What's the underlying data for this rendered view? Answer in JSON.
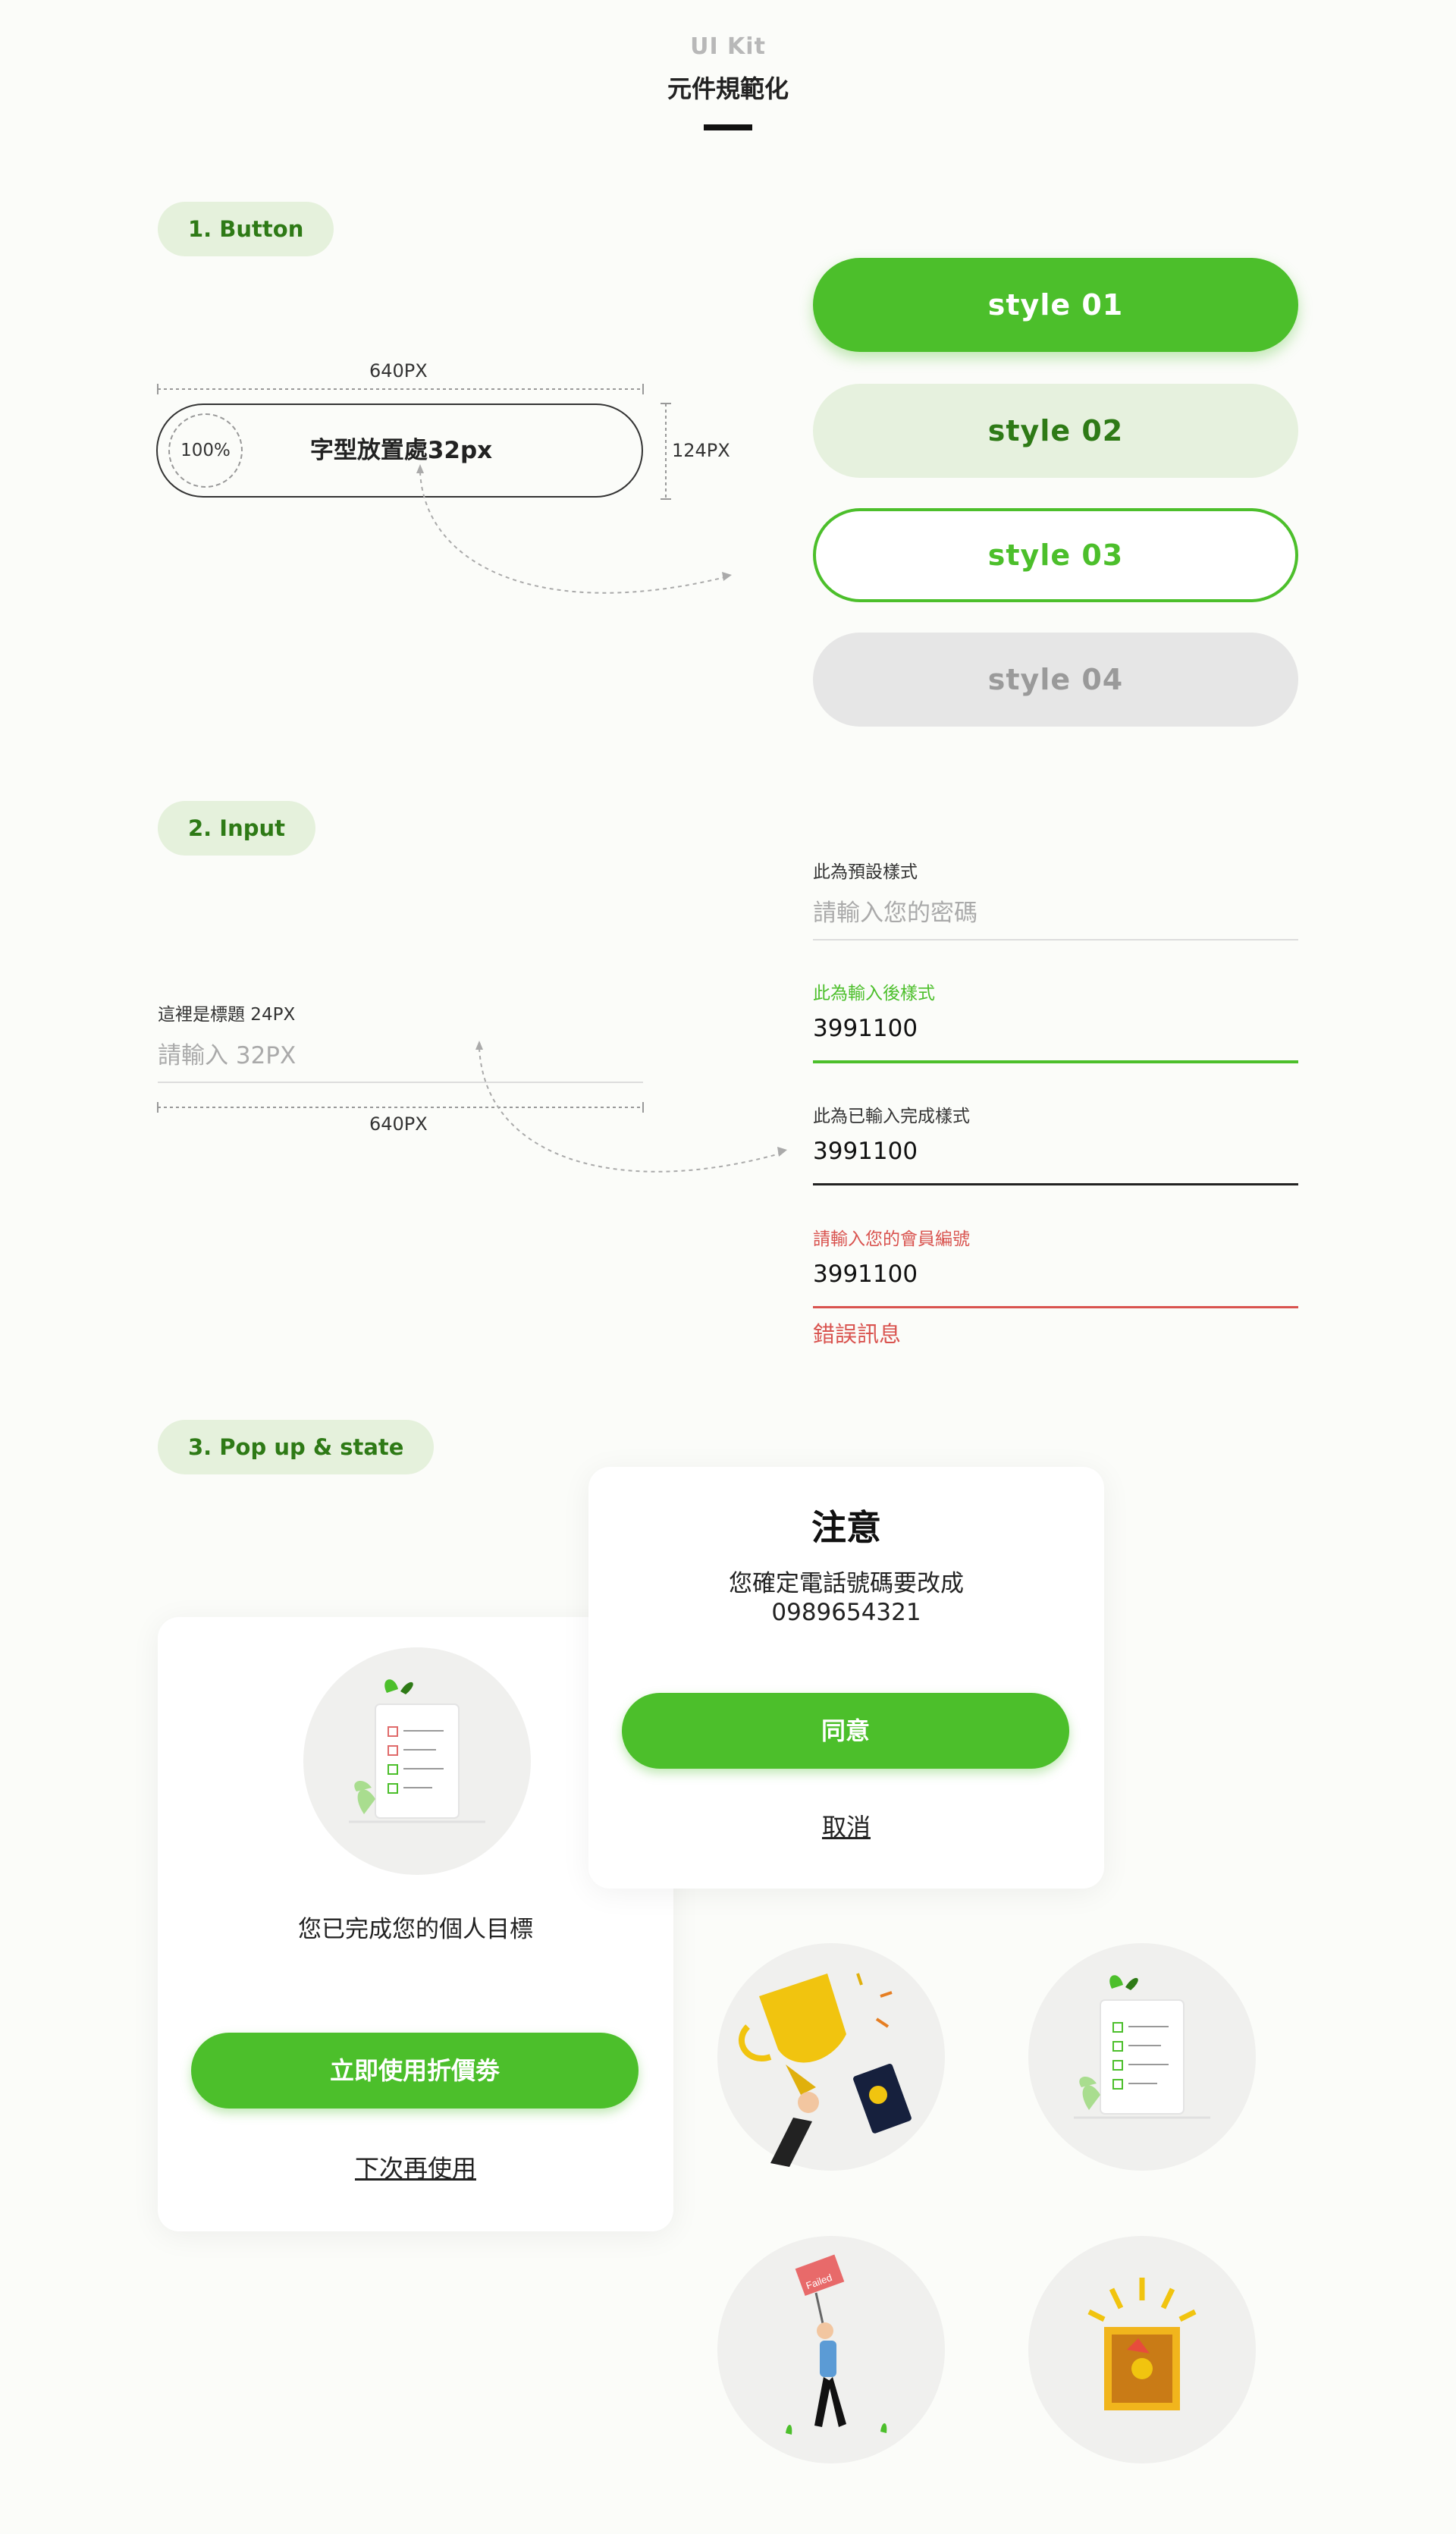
{
  "header": {
    "kit_label": "UI Kit",
    "title": "元件規範化"
  },
  "sections": {
    "button": "1. Button",
    "input": "2. Input",
    "popup": "3. Pop up & state"
  },
  "button_spec": {
    "width_label": "640PX",
    "height_label": "124PX",
    "radius_label": "100%",
    "text_label": "字型放置處32px"
  },
  "button_styles": [
    "style 01",
    "style 02",
    "style 03",
    "style 04"
  ],
  "input_spec": {
    "title_label": "這裡是標題 24PX",
    "placeholder": "請輸入 32PX",
    "width_label": "640PX"
  },
  "inputs": {
    "default": {
      "label": "此為預設樣式",
      "placeholder": "請輸入您的密碼"
    },
    "typing": {
      "label": "此為輸入後樣式",
      "value": "3991100"
    },
    "filled": {
      "label": "此為已輸入完成樣式",
      "value": "3991100"
    },
    "error": {
      "label": "請輸入您的會員編號",
      "value": "3991100",
      "message": "錯誤訊息"
    }
  },
  "popup_confirm": {
    "title": "注意",
    "message_line1": "您確定電話號碼要改成",
    "message_line2": "0989654321",
    "confirm_label": "同意",
    "cancel_label": "取消"
  },
  "popup_complete": {
    "message": "您已完成您的個人目標",
    "primary_label": "立即使用折價劵",
    "secondary_label": "下次再使用"
  },
  "illustrations": {
    "failed_sign": "Failed"
  },
  "colors": {
    "primary_green": "#4cbf2b",
    "dark_green": "#2e7a16",
    "light_green": "#e6f1de",
    "disabled_gray": "#e6e6e6",
    "error_red": "#d9534f"
  },
  "icons": [
    "checklist-illustration",
    "trophy-illustration",
    "failed-illustration",
    "treasure-chest-illustration"
  ]
}
